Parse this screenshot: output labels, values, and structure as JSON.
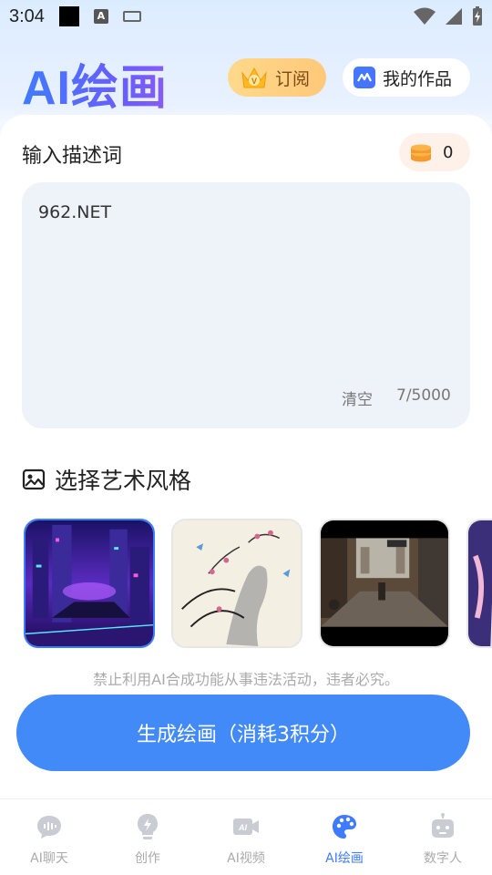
{
  "status_bar": {
    "time": "3:04",
    "keyboard_icon_label": "A"
  },
  "header": {
    "title": "AI绘画",
    "subscribe_label": "订阅",
    "my_works_label": "我的作品"
  },
  "input_section": {
    "title": "输入描述词",
    "credits": "0",
    "prompt_value": "962.NET",
    "clear_label": "清空",
    "char_count": "7/5000"
  },
  "style_section": {
    "title": "选择艺术风格",
    "styles": [
      {
        "name": "cyberpunk",
        "selected": true
      },
      {
        "name": "ink-painting",
        "selected": false
      },
      {
        "name": "photo-street",
        "selected": false
      },
      {
        "name": "anime",
        "selected": false
      }
    ]
  },
  "notice": "禁止利用AI合成功能从事违法活动，违者必究。",
  "generate_label": "生成绘画（消耗3积分）",
  "bottom_nav": {
    "items": [
      {
        "label": "AI聊天",
        "active": false
      },
      {
        "label": "创作",
        "active": false
      },
      {
        "label": "AI视频",
        "active": false
      },
      {
        "label": "AI绘画",
        "active": true
      },
      {
        "label": "数字人",
        "active": false
      }
    ]
  },
  "colors": {
    "accent": "#428af8",
    "active_nav": "#3f7bff",
    "inactive_nav": "#aaaaaa",
    "subscribe_bg": "#ffd98a"
  }
}
